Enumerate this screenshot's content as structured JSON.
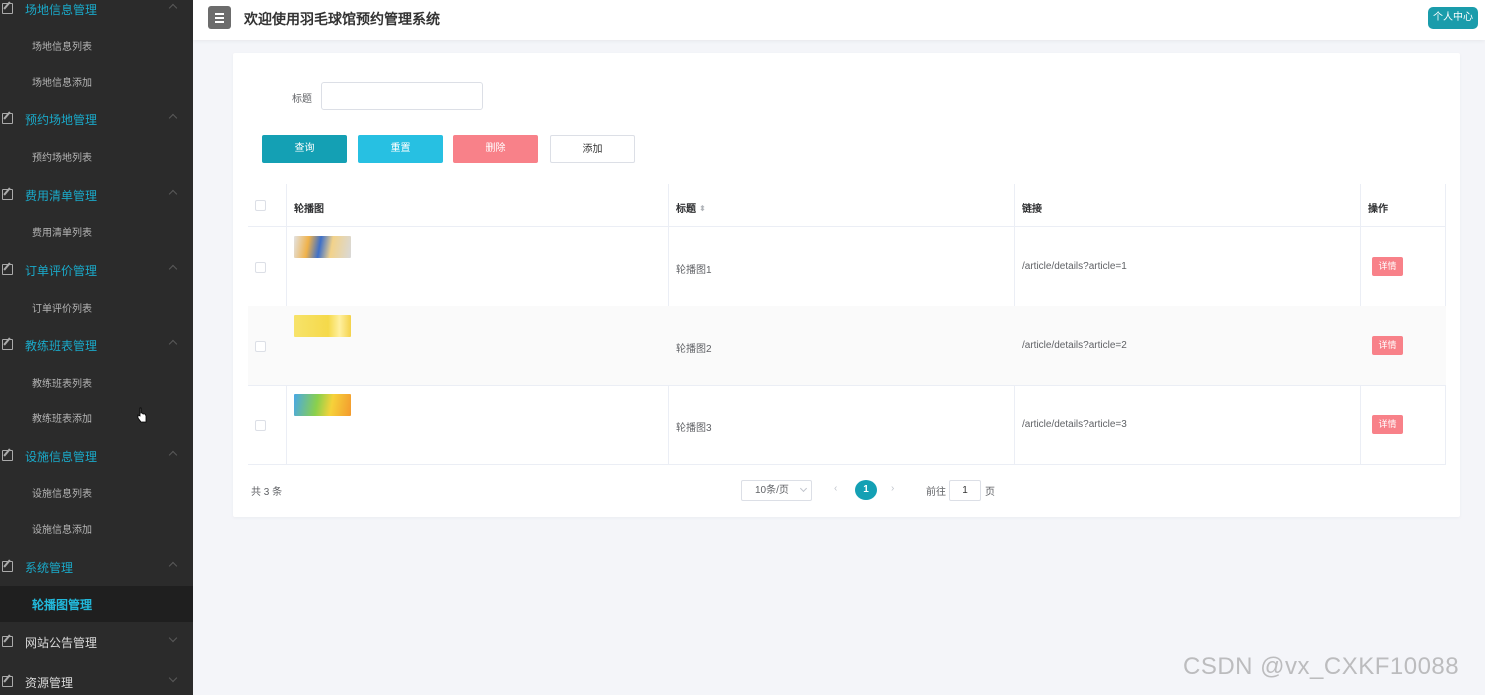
{
  "header": {
    "title": "欢迎使用羽毛球馆预约管理系统",
    "profile_label": "个人中心"
  },
  "sidebar": {
    "groups": [
      {
        "label": "场地信息管理",
        "items": [
          "场地信息列表",
          "场地信息添加"
        ]
      },
      {
        "label": "预约场地管理",
        "items": [
          "预约场地列表"
        ]
      },
      {
        "label": "费用清单管理",
        "items": [
          "费用清单列表"
        ]
      },
      {
        "label": "订单评价管理",
        "items": [
          "订单评价列表"
        ]
      },
      {
        "label": "教练班表管理",
        "items": [
          "教练班表列表",
          "教练班表添加"
        ]
      },
      {
        "label": "设施信息管理",
        "items": [
          "设施信息列表",
          "设施信息添加"
        ]
      },
      {
        "label": "系统管理",
        "items": [
          "轮播图管理"
        ]
      },
      {
        "label": "网站公告管理",
        "items": []
      },
      {
        "label": "资源管理",
        "items": []
      }
    ],
    "active_item": "轮播图管理"
  },
  "search": {
    "label": "标题",
    "value": "",
    "placeholder": ""
  },
  "actions": {
    "query": "查询",
    "reset": "重置",
    "delete": "删除",
    "add": "添加"
  },
  "table": {
    "headers": [
      "轮播图",
      "标题",
      "链接",
      "操作"
    ],
    "rows": [
      {
        "title": "轮播图1",
        "link": "/article/details?article=1",
        "action": "详情"
      },
      {
        "title": "轮播图2",
        "link": "/article/details?article=2",
        "action": "详情"
      },
      {
        "title": "轮播图3",
        "link": "/article/details?article=3",
        "action": "详情"
      }
    ]
  },
  "pagination": {
    "total": "共 3 条",
    "page_size": "10条/页",
    "current_page": "1",
    "goto_label": "前往",
    "goto_value": "1",
    "page_unit": "页"
  },
  "watermark": "CSDN @vx_CXKF10088",
  "colors": {
    "sidebar_bg": "#2b2b2b",
    "accent": "#14a0b4",
    "danger": "#f88189"
  }
}
